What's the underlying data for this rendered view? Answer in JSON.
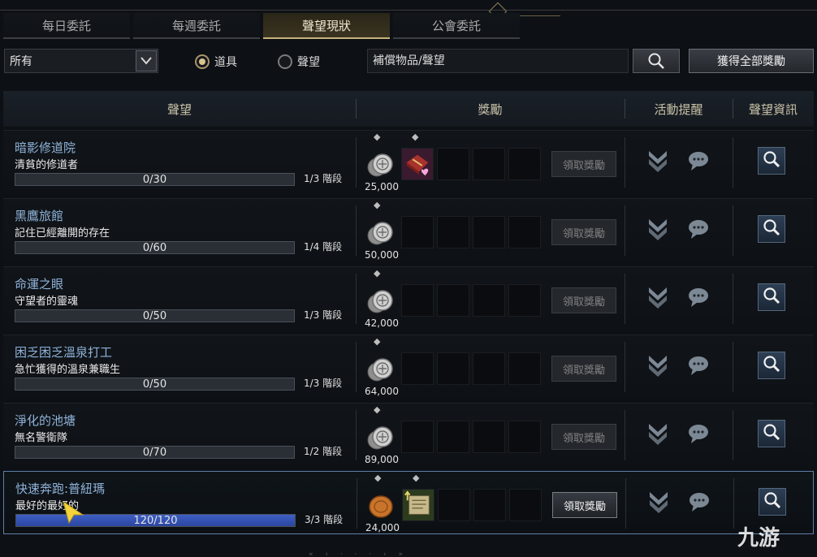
{
  "tabs": [
    "每日委託",
    "每週委託",
    "聲望現狀",
    "公會委託"
  ],
  "filter": {
    "category_value": "所有",
    "radio_items": "道具",
    "radio_reputation": "聲望",
    "search_placeholder": "補償物品/聲望",
    "claim_all_label": "獲得全部獎勵"
  },
  "columns": {
    "reputation": "聲望",
    "reward": "獎勵",
    "activity_alert": "活動提醒",
    "reputation_info": "聲望資訊"
  },
  "rows": [
    {
      "title": "暗影修道院",
      "subtitle": "清貧的修道者",
      "progress_text": "0/30",
      "progress_fraction": 0,
      "stage": "1/3 階段",
      "coin": "25,000",
      "claim": "領取獎勵",
      "claimable": false,
      "extra_item": "gift-box-icon"
    },
    {
      "title": "黑鷹旅館",
      "subtitle": "記住已經離開的存在",
      "progress_text": "0/60",
      "progress_fraction": 0,
      "stage": "1/4 階段",
      "coin": "50,000",
      "claim": "領取獎勵",
      "claimable": false
    },
    {
      "title": "命運之眼",
      "subtitle": "守望者的靈魂",
      "progress_text": "0/50",
      "progress_fraction": 0,
      "stage": "1/3 階段",
      "coin": "42,000",
      "claim": "領取獎勵",
      "claimable": false
    },
    {
      "title": "困乏困乏溫泉打工",
      "subtitle": "急忙獲得的溫泉兼職生",
      "progress_text": "0/50",
      "progress_fraction": 0,
      "stage": "1/3 階段",
      "coin": "64,000",
      "claim": "領取獎勵",
      "claimable": false
    },
    {
      "title": "淨化的池塘",
      "subtitle": "無名警衛隊",
      "progress_text": "0/70",
      "progress_fraction": 0,
      "stage": "1/2 階段",
      "coin": "89,000",
      "claim": "領取獎勵",
      "claimable": false
    },
    {
      "title": "快速奔跑:普紐瑪",
      "subtitle": "最好的最好的",
      "progress_text": "120/120",
      "progress_fraction": 1,
      "stage": "3/3 階段",
      "coin": "24,000",
      "claim": "領取獎勵",
      "claimable": true,
      "extra_item": "scroll-icon"
    }
  ],
  "watermark": "九游",
  "colors": {
    "accent_gold": "#c7b27a",
    "progress_blue": "#3e5fc4",
    "title_blue": "#8fb3da"
  }
}
